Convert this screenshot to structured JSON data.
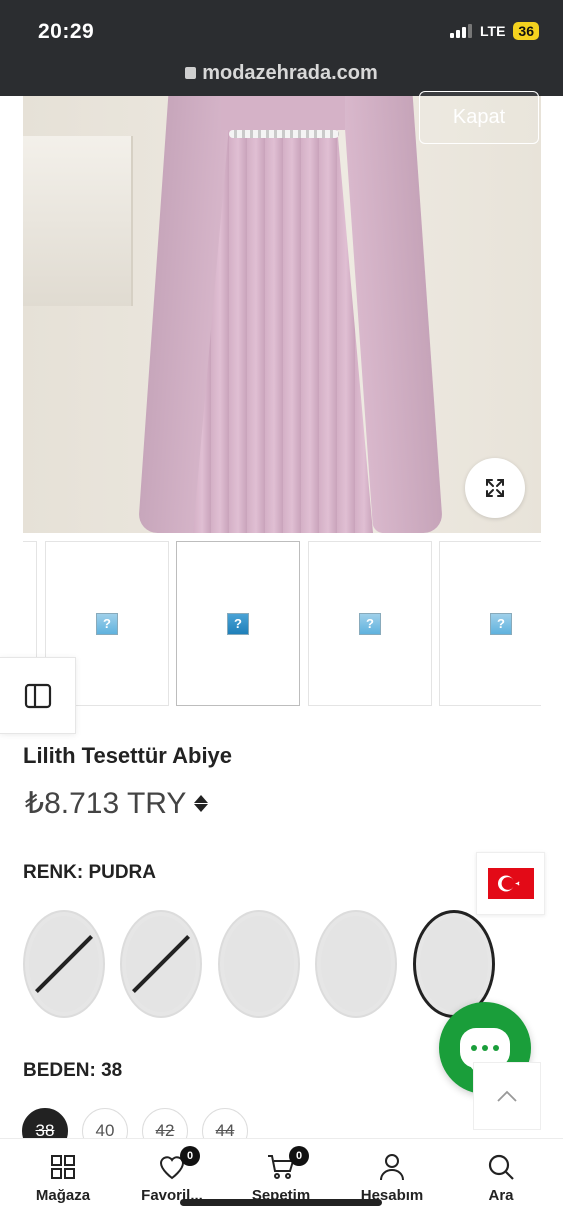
{
  "status_bar": {
    "time": "20:29",
    "network": "LTE",
    "battery": "36"
  },
  "browser": {
    "url": "modazehrada.com"
  },
  "gallery": {
    "close_label": "Kapat",
    "thumbnail_count": 5,
    "selected_thumbnail": 2
  },
  "product": {
    "title": "Lilith Tesettür Abiye",
    "price": "₺8.713 TRY",
    "color_label": "RENK: PUDRA",
    "size_label": "BEDEN: 38",
    "color_swatches": [
      {
        "available": false
      },
      {
        "available": false
      },
      {
        "available": true
      },
      {
        "available": true
      },
      {
        "available": true,
        "selected": true
      }
    ],
    "sizes": [
      {
        "label": "38",
        "selected": true,
        "unavailable": true
      },
      {
        "label": "40",
        "selected": false,
        "unavailable": false
      },
      {
        "label": "42",
        "selected": false,
        "unavailable": true
      },
      {
        "label": "44",
        "selected": false,
        "unavailable": true
      }
    ]
  },
  "bottom_nav": {
    "items": [
      {
        "label": "Mağaza",
        "icon": "grid-icon"
      },
      {
        "label": "Favoril...",
        "icon": "heart-icon",
        "badge": "0"
      },
      {
        "label": "Sepetim",
        "icon": "cart-icon",
        "badge": "0"
      },
      {
        "label": "Hesabım",
        "icon": "user-icon"
      },
      {
        "label": "Ara",
        "icon": "search-icon"
      }
    ]
  },
  "colors": {
    "accent": "#222222",
    "chat": "#1a9e3a",
    "flag": "#e30a17"
  }
}
